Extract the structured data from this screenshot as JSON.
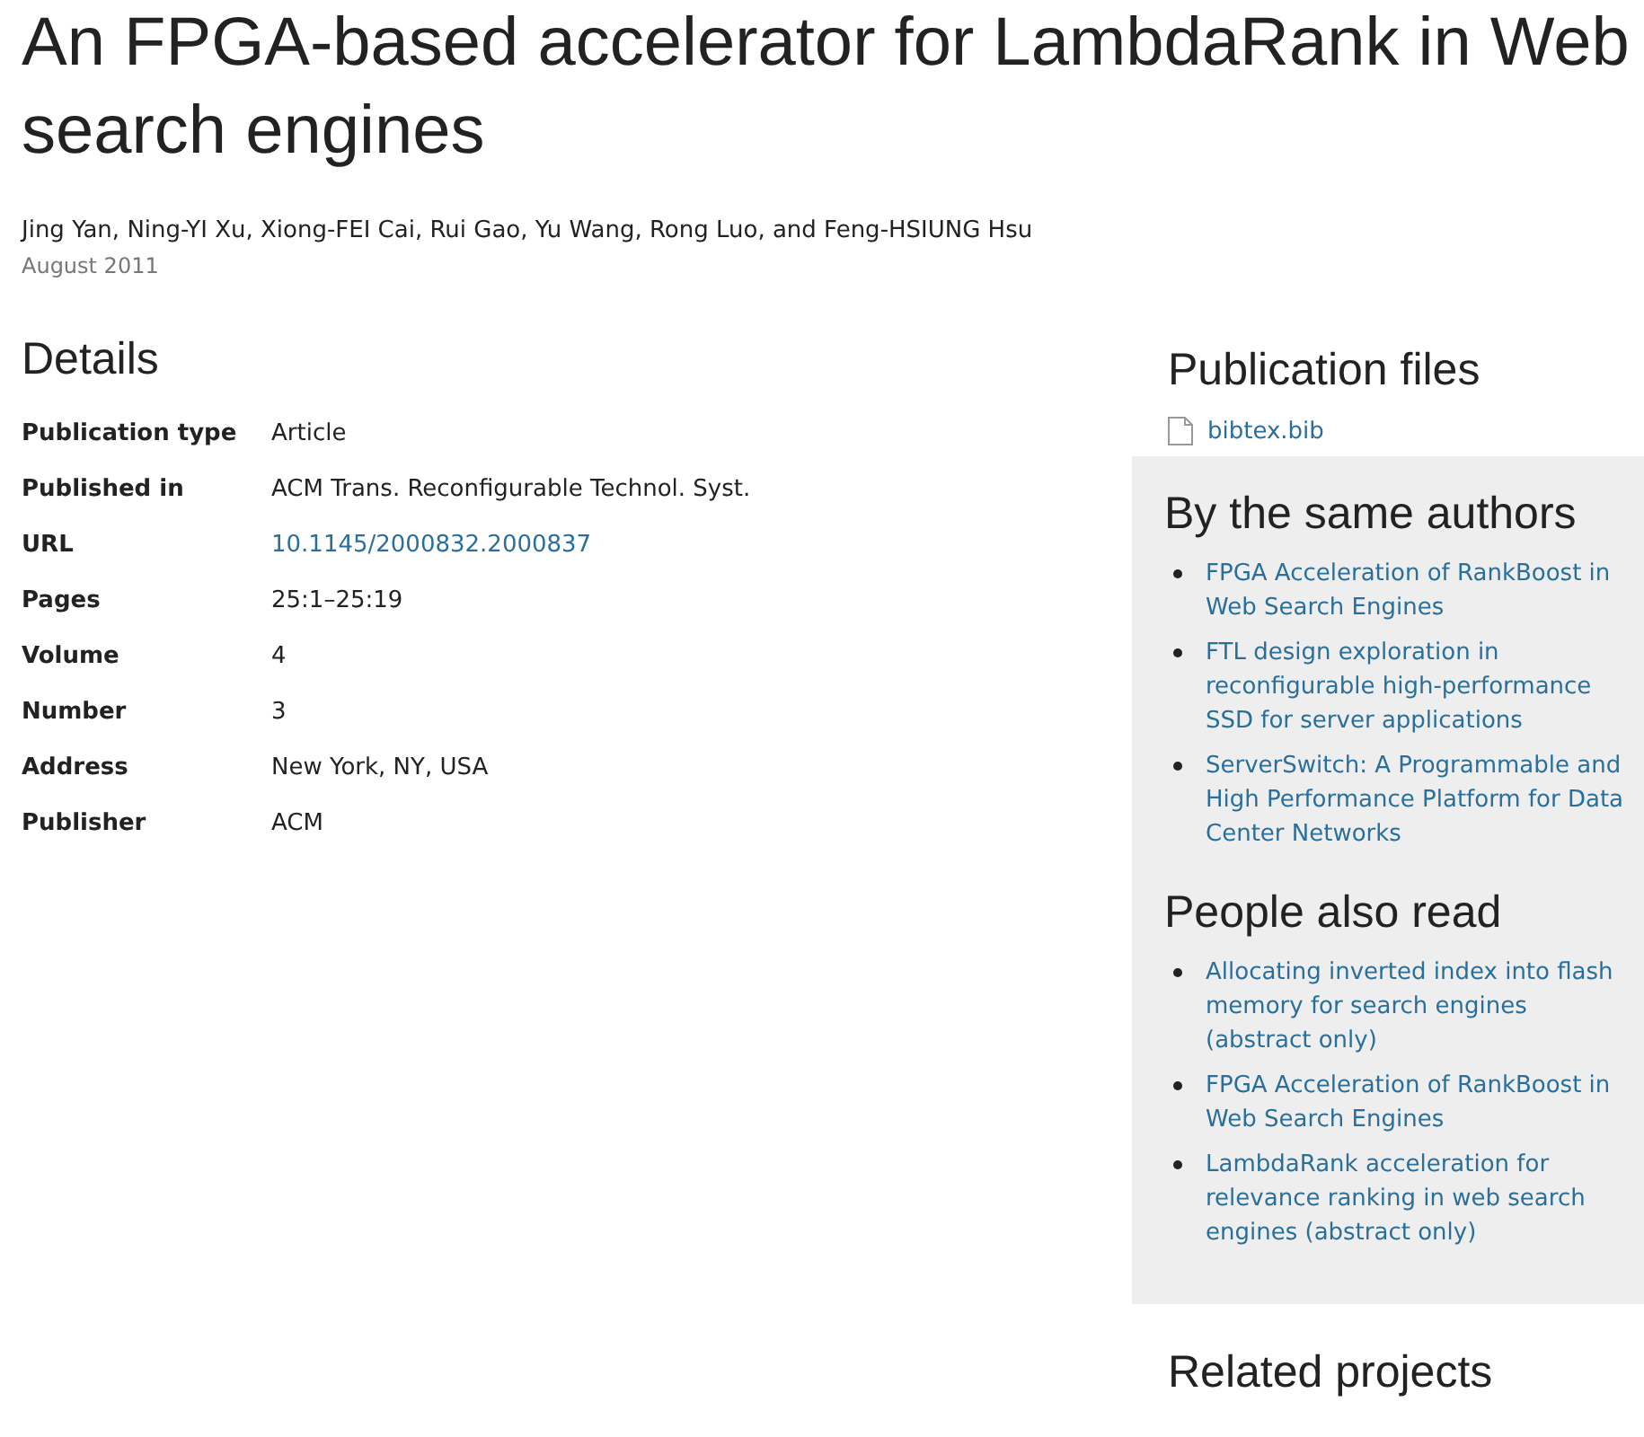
{
  "title": "An FPGA-based accelerator for LambdaRank in Web search engines",
  "authors": "Jing Yan, Ning-YI Xu, Xiong-FEI Cai, Rui Gao, Yu Wang, Rong Luo, and Feng-HSIUNG Hsu",
  "date": "August 2011",
  "details": {
    "heading": "Details",
    "rows": [
      {
        "label": "Publication type",
        "value": "Article",
        "kind": "text"
      },
      {
        "label": "Published in",
        "value": "ACM Trans. Reconfigurable Technol. Syst.",
        "kind": "text"
      },
      {
        "label": "URL",
        "value": "10.1145/2000832.2000837",
        "kind": "link"
      },
      {
        "label": "Pages",
        "value": "25:1–25:19",
        "kind": "text"
      },
      {
        "label": "Volume",
        "value": "4",
        "kind": "text"
      },
      {
        "label": "Number",
        "value": "3",
        "kind": "text"
      },
      {
        "label": "Address",
        "value": "New York, NY, USA",
        "kind": "text"
      },
      {
        "label": "Publisher",
        "value": "ACM",
        "kind": "text"
      }
    ]
  },
  "publication_files": {
    "heading": "Publication files",
    "files": [
      "bibtex.bib"
    ]
  },
  "same_authors": {
    "heading": "By the same authors",
    "items": [
      "FPGA Acceleration of RankBoost in Web Search Engines",
      "FTL design exploration in reconfigurable high-performance SSD for server applications",
      "ServerSwitch: A Programmable and High Performance Platform for Data Center Networks"
    ]
  },
  "people_also_read": {
    "heading": "People also read",
    "items": [
      "Allocating inverted index into flash memory for search engines (abstract only)",
      "FPGA Acceleration of RankBoost in Web Search Engines",
      "LambdaRank acceleration for relevance ranking in web search engines (abstract only)"
    ]
  },
  "related_projects": {
    "heading": "Related projects"
  }
}
